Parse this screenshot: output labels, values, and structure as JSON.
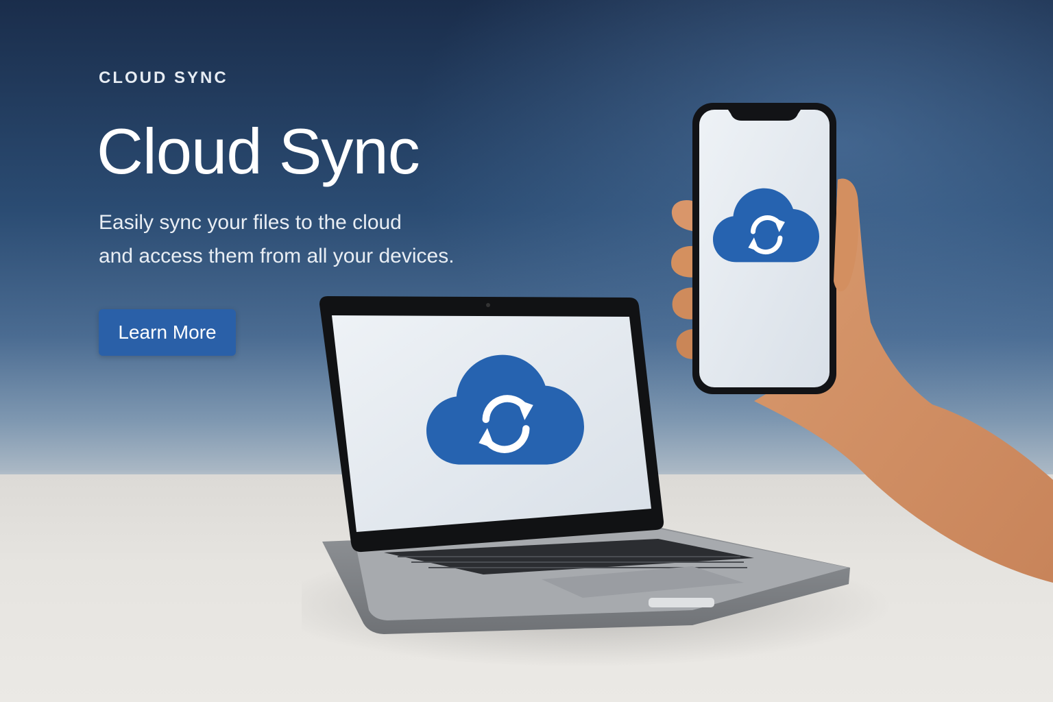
{
  "hero": {
    "eyebrow": "CLOUD SYNC",
    "title": "Cloud Sync",
    "subtitle_line1": "Easily sync your files to the cloud",
    "subtitle_line2": "and access them from all your devices.",
    "cta_label": "Learn More"
  },
  "icons": {
    "laptop_screen": "cloud-sync-icon",
    "phone_screen": "cloud-sync-icon"
  },
  "colors": {
    "accent": "#2a60a8",
    "cloud_blue": "#2663b0",
    "background_top": "#1a2d4b",
    "background_bottom": "#a9b7c4",
    "table": "#e6e4e0",
    "screen": "#e4e9ef"
  }
}
